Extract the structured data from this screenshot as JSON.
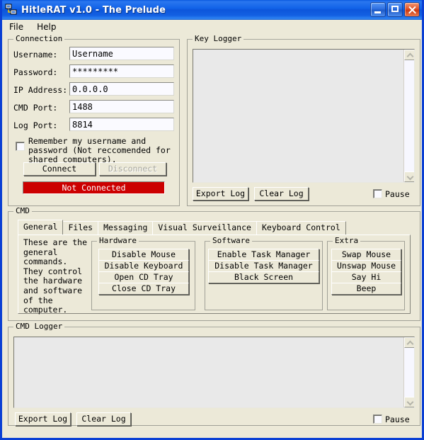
{
  "window": {
    "title": "HitleRAT v1.0 - The Prelude",
    "icon": "network-computer-icon",
    "controls": {
      "minimize": "minimize-button",
      "maximize": "maximize-button",
      "close": "close-button"
    }
  },
  "menubar": {
    "items": [
      {
        "label": "File"
      },
      {
        "label": "Help"
      }
    ]
  },
  "connection": {
    "title": "Connection",
    "fields": [
      {
        "label": "Username:",
        "value": "Username"
      },
      {
        "label": "Password:",
        "value": "*********"
      },
      {
        "label": "IP Address:",
        "value": "0.0.0.0"
      },
      {
        "label": "CMD Port:",
        "value": "1488"
      },
      {
        "label": "Log Port:",
        "value": "8814"
      }
    ],
    "remember_checkbox": {
      "label": "Remember my username and password (Not reccomended for shared computers).",
      "checked": false
    },
    "connect_button": "Connect",
    "disconnect_button": "Disconnect",
    "disconnect_disabled": true,
    "status": "Not Connected",
    "status_color": "#cc0000"
  },
  "key_logger": {
    "title": "Key Logger",
    "content": "",
    "export_button": "Export Log",
    "clear_button": "Clear Log",
    "pause_label": "Pause",
    "pause_checked": false
  },
  "cmd": {
    "title": "CMD",
    "tabs": [
      {
        "label": "General",
        "active": true
      },
      {
        "label": "Files",
        "active": false
      },
      {
        "label": "Messaging",
        "active": false
      },
      {
        "label": "Visual Surveillance",
        "active": false
      },
      {
        "label": "Keyboard Control",
        "active": false
      }
    ],
    "description": "These are the general commands. They control the hardware and software of the computer.",
    "groups": [
      {
        "title": "Hardware",
        "buttons": [
          "Disable Mouse",
          "Disable Keyboard",
          "Open CD Tray",
          "Close CD Tray"
        ]
      },
      {
        "title": "Software",
        "buttons": [
          "Enable Task Manager",
          "Disable Task Manager",
          "Black Screen"
        ]
      },
      {
        "title": "Extra",
        "buttons": [
          "Swap Mouse",
          "Unswap Mouse",
          "Say Hi",
          "Beep"
        ]
      }
    ]
  },
  "cmd_logger": {
    "title": "CMD Logger",
    "content": "",
    "export_button": "Export Log",
    "clear_button": "Clear Log",
    "pause_label": "Pause",
    "pause_checked": false
  }
}
